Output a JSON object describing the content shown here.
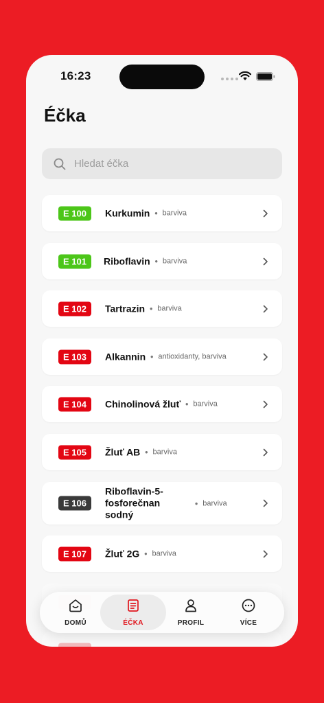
{
  "status_bar": {
    "time": "16:23"
  },
  "header": {
    "title": "Éčka"
  },
  "search": {
    "placeholder": "Hledat éčka",
    "icon": "search-icon"
  },
  "colors": {
    "green": "#4cc619",
    "red": "#e30613",
    "dark": "#3a3a3a",
    "brand": "#ec1c24"
  },
  "items": [
    {
      "code": "E 100",
      "name": "Kurkumin",
      "category": "barviva",
      "badge_color": "#4cc619"
    },
    {
      "code": "E 101",
      "name": "Riboflavin",
      "category": "barviva",
      "badge_color": "#4cc619"
    },
    {
      "code": "E 102",
      "name": "Tartrazin",
      "category": "barviva",
      "badge_color": "#e30613"
    },
    {
      "code": "E 103",
      "name": "Alkannin",
      "category": "antioxidanty, barviva",
      "badge_color": "#e30613"
    },
    {
      "code": "E 104",
      "name": "Chinolinová žluť",
      "category": "barviva",
      "badge_color": "#e30613"
    },
    {
      "code": "E 105",
      "name": "Žluť AB",
      "category": "barviva",
      "badge_color": "#e30613"
    },
    {
      "code": "E 106",
      "name": "Riboflavin-5-fosforečnan sodný",
      "category": "barviva",
      "badge_color": "#3a3a3a"
    },
    {
      "code": "E 107",
      "name": "Žluť 2G",
      "category": "barviva",
      "badge_color": "#e30613"
    }
  ],
  "tabs": [
    {
      "label": "DOMŮ",
      "icon": "home-icon",
      "active": false
    },
    {
      "label": "ÉČKA",
      "icon": "list-icon",
      "active": true
    },
    {
      "label": "PROFIL",
      "icon": "person-icon",
      "active": false
    },
    {
      "label": "VÍCE",
      "icon": "more-icon",
      "active": false
    }
  ]
}
